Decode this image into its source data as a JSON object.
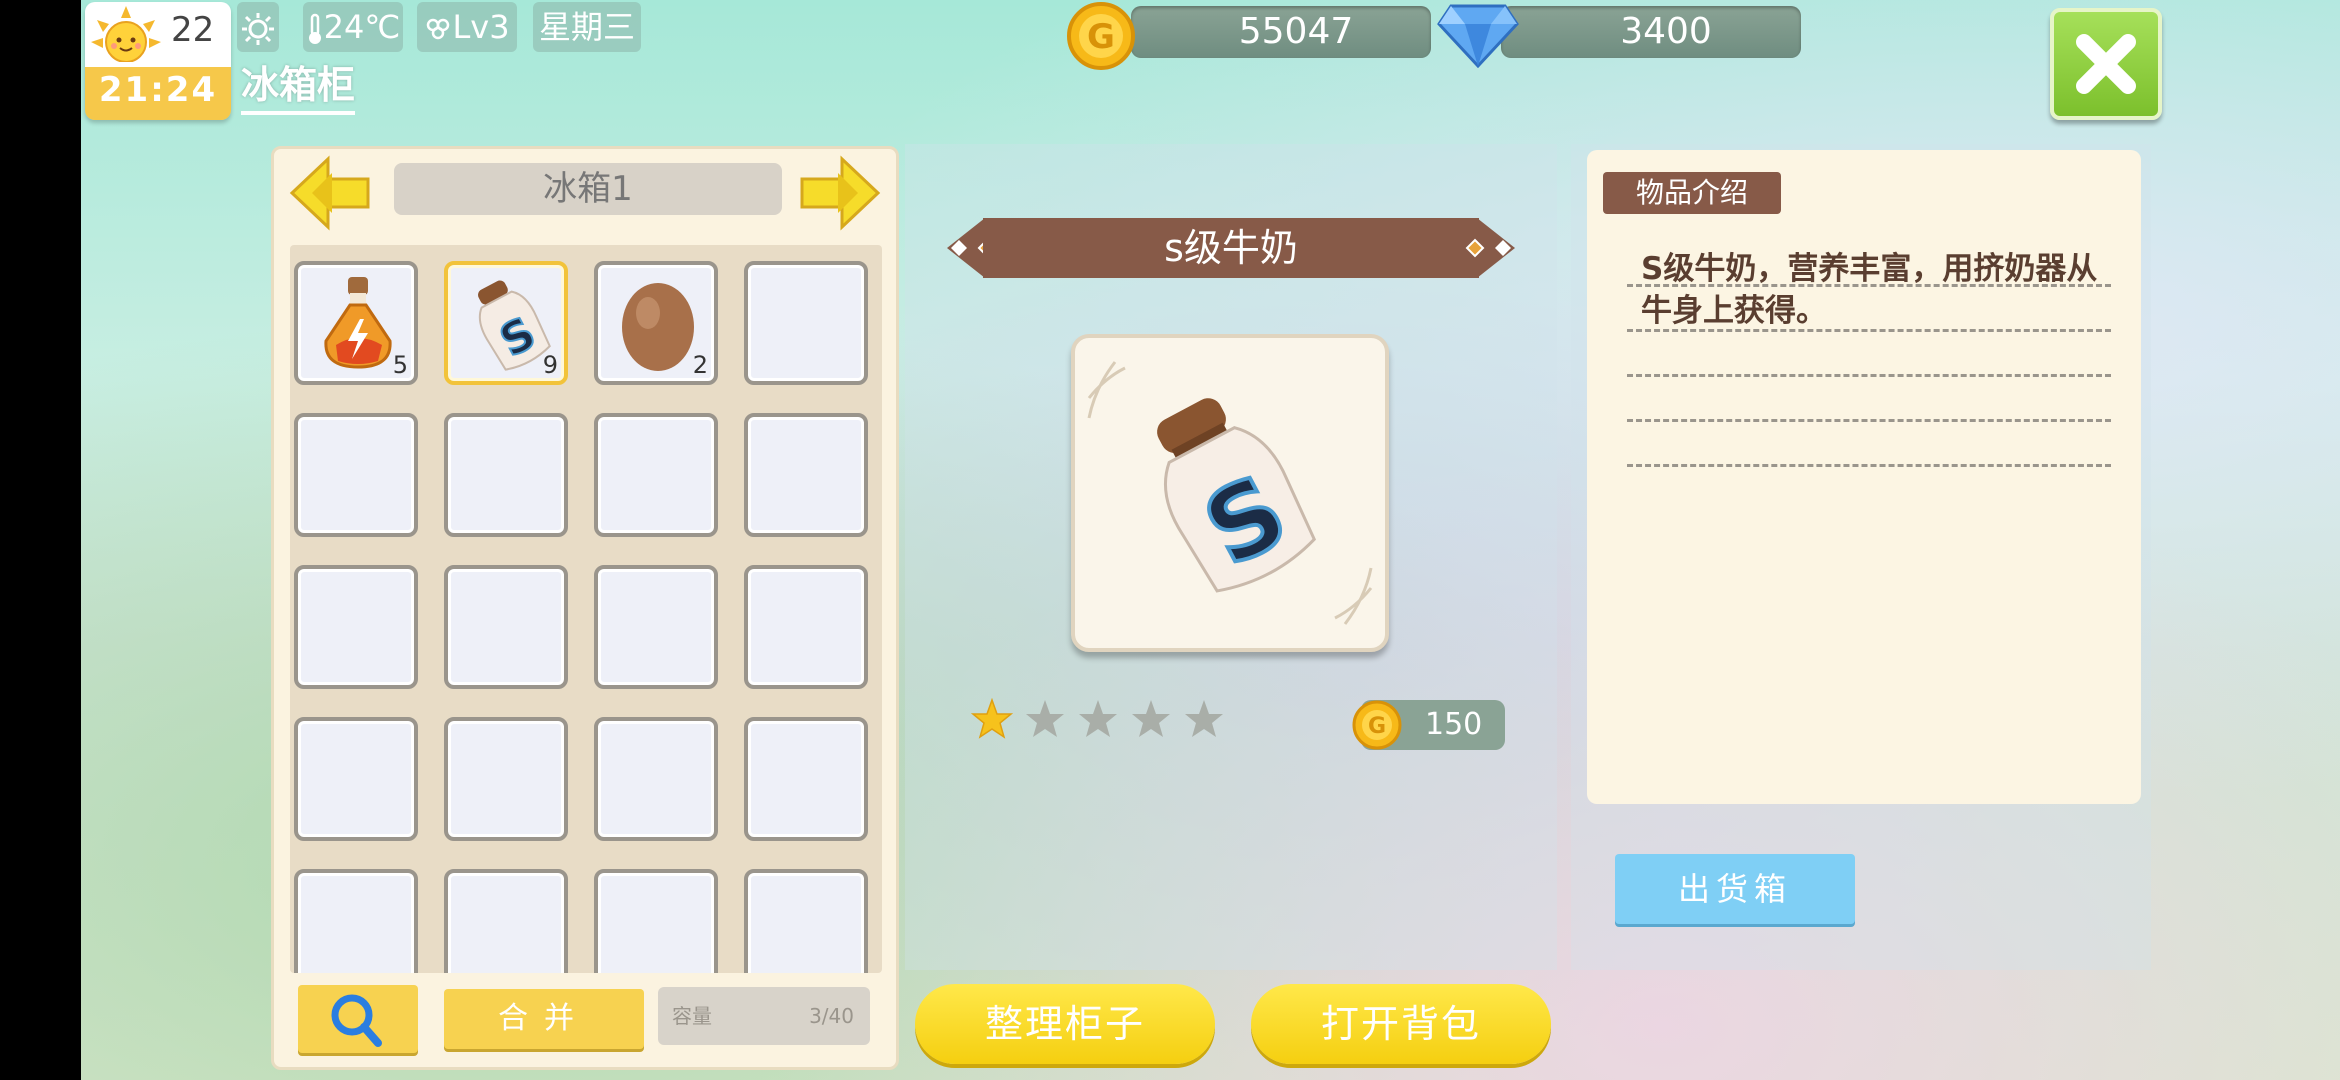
{
  "status": {
    "day": "22",
    "time": "21:24",
    "temperature": "24℃",
    "level": "Lv3",
    "weekday": "星期三"
  },
  "tab": {
    "label": "冰箱柜"
  },
  "currency": {
    "gold": "55047",
    "diamond": "3400"
  },
  "fridge": {
    "name": "冰箱1",
    "slots": [
      {
        "item": "elixir",
        "count": "5"
      },
      {
        "item": "s-milk",
        "count": "9",
        "selected": true
      },
      {
        "item": "egg",
        "count": "2"
      }
    ],
    "merge_label": "合并",
    "capacity_label": "容量",
    "capacity_value": "3/40"
  },
  "item": {
    "name": "s级牛奶",
    "stars": 1,
    "max_stars": 5,
    "price": "150"
  },
  "description": {
    "heading": "物品介绍",
    "text": "S级牛奶，营养丰富，用挤奶器从牛身上获得。"
  },
  "buttons": {
    "ship": "出货箱",
    "organize": "整理柜子",
    "open_bag": "打开背包"
  },
  "colors": {
    "accent_yellow": "#f7d250",
    "banner_brown": "#875a48",
    "close_green": "#8ccf3c",
    "ship_blue": "#7fcff5"
  }
}
